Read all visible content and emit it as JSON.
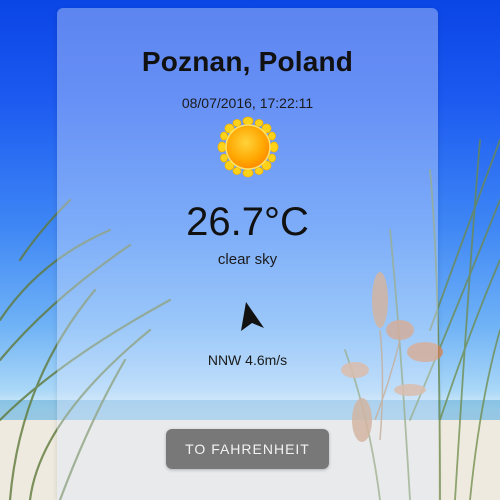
{
  "weather": {
    "location": "Poznan, Poland",
    "datetime": "08/07/2016, 17:22:11",
    "icon": "sun-icon",
    "temperature": "26.7°C",
    "condition": "clear sky",
    "wind_icon": "wind-direction-arrow-icon",
    "wind": "NNW 4.6m/s",
    "unit_toggle_label": "TO FAHRENHEIT"
  },
  "colors": {
    "sky_top": "#0a45e6",
    "sun_yellow": "#ffd21a",
    "sun_orange": "#ff9a00",
    "button_bg": "#5f5f5f"
  }
}
